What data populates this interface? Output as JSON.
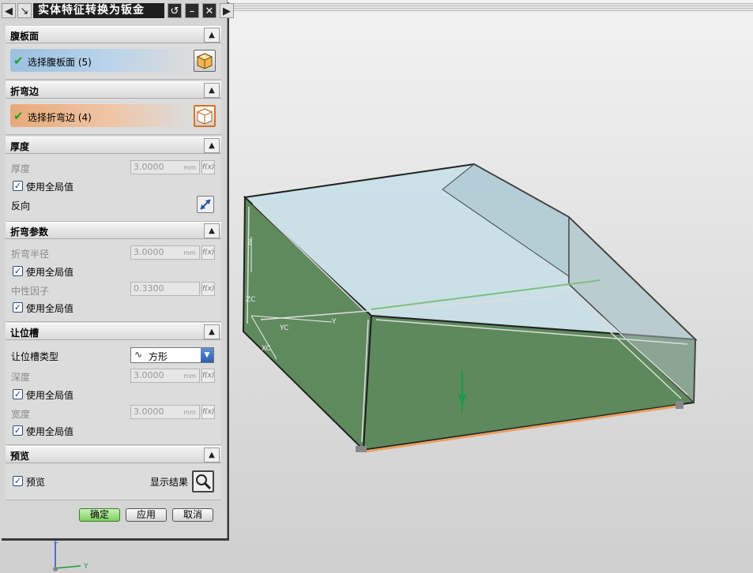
{
  "dialog": {
    "title": "实体特征转换为钣金",
    "sections": {
      "web_face": {
        "header": "腹板面",
        "select_label": "选择腹板面 (5)"
      },
      "bend_edge": {
        "header": "折弯边",
        "select_label": "选择折弯边 (4)"
      },
      "thickness": {
        "header": "厚度",
        "label": "厚度",
        "value": "3.0000",
        "unit": "mm",
        "use_global": "使用全局值",
        "reverse": "反向"
      },
      "bend_params": {
        "header": "折弯参数",
        "radius_label": "折弯半径",
        "radius_value": "3.0000",
        "radius_unit": "mm",
        "use_global_1": "使用全局值",
        "neutral_label": "中性因子",
        "neutral_value": "0.3300",
        "use_global_2": "使用全局值"
      },
      "relief": {
        "header": "让位槽",
        "type_label": "让位槽类型",
        "type_value": "方形",
        "depth_label": "深度",
        "depth_value": "3.0000",
        "depth_unit": "mm",
        "use_global_1": "使用全局值",
        "width_label": "宽度",
        "width_value": "3.0000",
        "width_unit": "mm",
        "use_global_2": "使用全局值"
      },
      "preview": {
        "header": "预览",
        "preview_label": "预览",
        "show_result": "显示结果"
      }
    },
    "buttons": {
      "ok": "确定",
      "apply": "应用",
      "cancel": "取消"
    },
    "fx_label": "f(x)"
  },
  "viewport": {
    "axis_labels": {
      "z": "Z",
      "zc": "ZC",
      "y": "Y",
      "yc": "YC",
      "xc": "XC",
      "triad_z": "Z",
      "triad_y": "Y"
    }
  },
  "colors": {
    "web_face_highlight": "#b9d3ea",
    "bend_edge_highlight": "#efc5a4",
    "solid_face": "#5f8a5e",
    "top_face": "#c5dfe8"
  }
}
